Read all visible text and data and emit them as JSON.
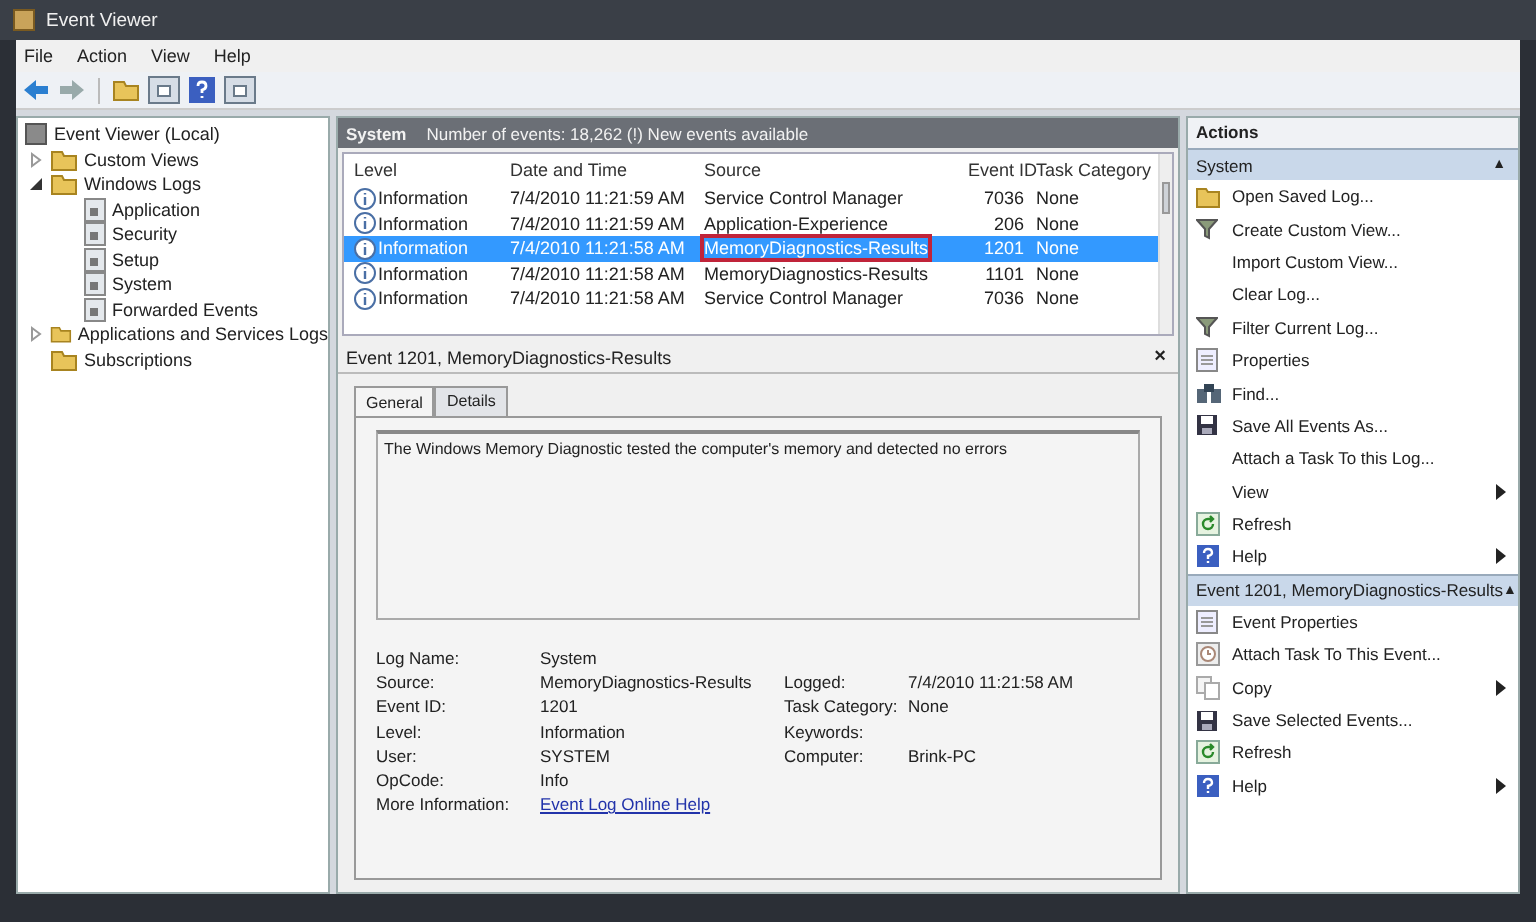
{
  "window": {
    "title": "Event Viewer"
  },
  "menu": [
    {
      "label": "File"
    },
    {
      "label": "Action"
    },
    {
      "label": "View"
    },
    {
      "label": "Help"
    }
  ],
  "toolbar": [
    {
      "kind": "back"
    },
    {
      "kind": "forward"
    },
    {
      "kind": "sep"
    },
    {
      "kind": "folder"
    },
    {
      "kind": "panel"
    },
    {
      "kind": "help"
    },
    {
      "kind": "panel"
    }
  ],
  "tree": [
    {
      "label": "Event Viewer (Local)",
      "children": [
        {
          "label": "Custom Views",
          "expanded": false
        },
        {
          "label": "Windows Logs",
          "expanded": true,
          "children": [
            {
              "label": "Application"
            },
            {
              "label": "Security"
            },
            {
              "label": "Setup"
            },
            {
              "label": "System"
            },
            {
              "label": "Forwarded Events"
            }
          ]
        },
        {
          "label": "Applications and Services Logs",
          "expanded": false
        },
        {
          "label": "Subscriptions"
        }
      ]
    }
  ],
  "log_header": {
    "name": "System",
    "info": "Number of events: 18,262 (!) New events available"
  },
  "table": {
    "columns": [
      "Level",
      "Date and Time",
      "Source",
      "Event ID",
      "Task Category"
    ],
    "rows": [
      {
        "level": "Information",
        "date": "7/4/2010 11:21:59 AM",
        "source": "Service Control Manager",
        "id": "7036",
        "category": "None",
        "selected": false,
        "outlined": false
      },
      {
        "level": "Information",
        "date": "7/4/2010 11:21:59 AM",
        "source": "Application-Experience",
        "id": "206",
        "category": "None",
        "selected": false,
        "outlined": false
      },
      {
        "level": "Information",
        "date": "7/4/2010 11:21:58 AM",
        "source": "MemoryDiagnostics-Results",
        "id": "1201",
        "category": "None",
        "selected": true,
        "outlined": true
      },
      {
        "level": "Information",
        "date": "7/4/2010 11:21:58 AM",
        "source": "MemoryDiagnostics-Results",
        "id": "1101",
        "category": "None",
        "selected": false,
        "outlined": false
      },
      {
        "level": "Information",
        "date": "7/4/2010 11:21:58 AM",
        "source": "Service Control Manager",
        "id": "7036",
        "category": "None",
        "selected": false,
        "outlined": false
      }
    ]
  },
  "detail": {
    "title": "Event 1201, MemoryDiagnostics-Results",
    "close": "×",
    "tabs": [
      {
        "label": "General",
        "selected": true
      },
      {
        "label": "Details",
        "selected": false
      }
    ],
    "message": "The Windows Memory Diagnostic tested the computer's memory and detected no errors",
    "fields": [
      {
        "label": "Log Name:",
        "value": "System"
      },
      {
        "label": "Source:",
        "value": "MemoryDiagnostics-Results",
        "label2": "Logged:",
        "value2": "7/4/2010 11:21:58 AM"
      },
      {
        "label": "Event ID:",
        "value": "1201",
        "label2": "Task Category:",
        "value2": "None"
      },
      {
        "label": "Level:",
        "value": "Information",
        "label2": "Keywords:"
      },
      {
        "label": "User:",
        "value": "SYSTEM",
        "label2": "Computer:",
        "value2": "Brink-PC"
      },
      {
        "label": "OpCode:",
        "value": "Info"
      }
    ],
    "more_label": "More Information:",
    "more_link": "Event Log Online Help"
  },
  "actions": {
    "title": "Actions",
    "sections": [
      {
        "title": "System",
        "caret": "▲",
        "items": [
          {
            "label": "Open Saved Log...",
            "submenu": false
          },
          {
            "label": "Create Custom View...",
            "submenu": false
          },
          {
            "label": "Import Custom View...",
            "submenu": false
          },
          {
            "label": "Clear Log...",
            "submenu": false
          },
          {
            "label": "Filter Current Log...",
            "submenu": false
          },
          {
            "label": "Properties",
            "submenu": false
          },
          {
            "label": "Find...",
            "submenu": false
          },
          {
            "label": "Save All Events As...",
            "submenu": false
          },
          {
            "label": "Attach a Task To this Log...",
            "submenu": false
          },
          {
            "label": "View",
            "submenu": true
          },
          {
            "label": "Refresh",
            "submenu": false
          },
          {
            "label": "Help",
            "submenu": true
          }
        ]
      },
      {
        "title": "Event 1201, MemoryDiagnostics-Results",
        "caret": "▲",
        "items": [
          {
            "label": "Event Properties",
            "submenu": false
          },
          {
            "label": "Attach Task To This Event...",
            "submenu": false
          },
          {
            "label": "Copy",
            "submenu": true
          },
          {
            "label": "Save Selected Events...",
            "submenu": false
          },
          {
            "label": "Refresh",
            "submenu": false
          },
          {
            "label": "Help",
            "submenu": true
          }
        ]
      }
    ]
  }
}
